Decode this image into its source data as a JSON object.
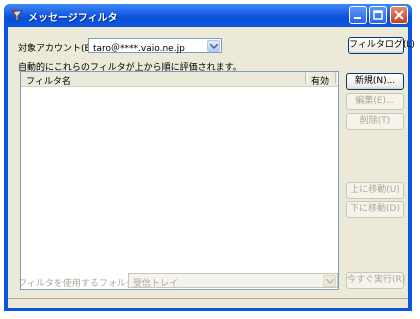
{
  "window": {
    "title": "メッセージフィルタ"
  },
  "account": {
    "label": "対象アカウント(E):",
    "value": "taro＠****.vaio.ne.jp",
    "filter_log_button": "フィルタログ(L)"
  },
  "description": "自動的にこれらのフィルタが上から順に評価されます。",
  "list": {
    "columns": [
      "フィルタ名",
      "有効"
    ]
  },
  "buttons": {
    "new": "新規(N)...",
    "edit": "編集(E)...",
    "delete": "削除(T)",
    "move_up": "上に移動(U)",
    "move_down": "下に移動(D)"
  },
  "footer": {
    "folder_label": "フィルタを使用するフォルダ(C):",
    "folder_value": "受信トレイ",
    "run_now": "今すぐ実行(R)"
  },
  "colors": {
    "titlebar": "#0b56e2",
    "client": "#ece9d8",
    "close": "#c8401c"
  }
}
